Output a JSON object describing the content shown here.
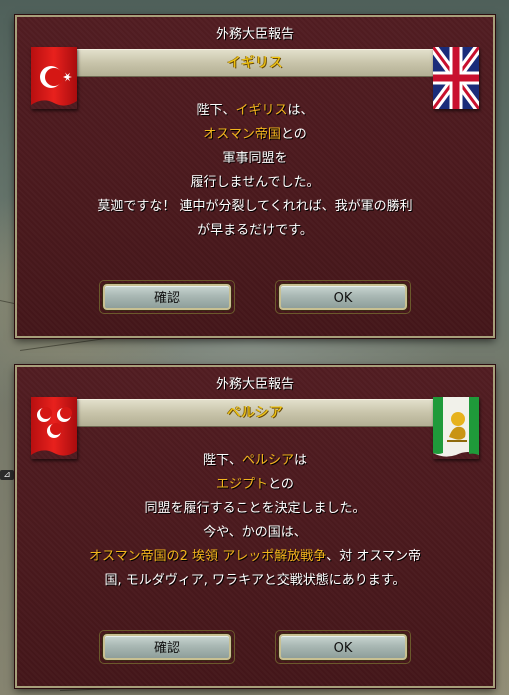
{
  "colors": {
    "dialog_bg": "#4a1a1e",
    "highlight": "#f2b51d",
    "banner_text": "#f4c60c",
    "border": "#a79f7a"
  },
  "dialogs": [
    {
      "title": "外務大臣報告",
      "banner": "イギリス",
      "flag_left": "ottoman-flag-icon",
      "flag_right": "union-jack-flag-icon",
      "lines": [
        [
          {
            "t": "陛下、"
          },
          {
            "t": "イギリス",
            "hl": true
          },
          {
            "t": "は、"
          }
        ],
        [
          {
            "t": "オスマン帝国",
            "hl": true
          },
          {
            "t": "との"
          }
        ],
        [
          {
            "t": "軍事同盟を"
          }
        ],
        [
          {
            "t": "履行しませんでした。"
          }
        ],
        [
          {
            "t": "莫迦ですな！ 連中が分裂してくれれば、我が軍の勝利"
          }
        ],
        [
          {
            "t": "が早まるだけです。"
          }
        ]
      ],
      "buttons": {
        "confirm": "確認",
        "ok": "OK"
      }
    },
    {
      "title": "外務大臣報告",
      "banner": "ペルシア",
      "flag_left": "triple-crescent-flag-icon",
      "flag_right": "persia-lion-flag-icon",
      "lines": [
        [
          {
            "t": "陛下、"
          },
          {
            "t": "ペルシア",
            "hl": true
          },
          {
            "t": "は"
          }
        ],
        [
          {
            "t": "エジプト",
            "hl": true
          },
          {
            "t": "との"
          }
        ],
        [
          {
            "t": "同盟を履行することを決定しました。"
          }
        ],
        [
          {
            "t": "今や、かの国は、"
          }
        ],
        [
          {
            "t": "オスマン帝国の2 埃領 アレッポ解放戦争",
            "hl": true
          },
          {
            "t": "、対 オスマン帝"
          }
        ],
        [
          {
            "t": "国, モルダヴィア, ワラキアと交戦状態にあります。"
          }
        ]
      ],
      "buttons": {
        "confirm": "確認",
        "ok": "OK"
      }
    }
  ]
}
